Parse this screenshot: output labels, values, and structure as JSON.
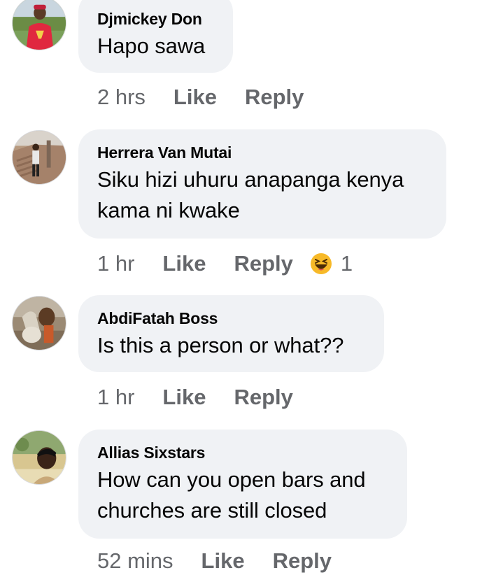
{
  "comments": [
    {
      "author": "Djmickey Don",
      "text_lines": [
        "Hapo sawa"
      ],
      "time": "2 hrs",
      "like_label": "Like",
      "reply_label": "Reply"
    },
    {
      "author": "Herrera Van Mutai",
      "text_lines": [
        "Siku hizi uhuru anapanga kenya",
        "kama ni kwake"
      ],
      "time": "1 hr",
      "like_label": "Like",
      "reply_label": "Reply",
      "reaction": {
        "icon": "laughing-emoji-icon",
        "count": "1"
      }
    },
    {
      "author": "AbdiFatah Boss",
      "text_lines": [
        "Is this a person or what??"
      ],
      "time": "1 hr",
      "like_label": "Like",
      "reply_label": "Reply"
    },
    {
      "author": "Allias Sixstars",
      "text_lines": [
        "How can you open bars and",
        "churches are still closed"
      ],
      "time": "52 mins",
      "like_label": "Like",
      "reply_label": "Reply"
    }
  ],
  "colors": {
    "bubble": "#f0f2f5",
    "text": "#050505",
    "secondary": "#65676b",
    "emoji_face": "#f7b928"
  }
}
